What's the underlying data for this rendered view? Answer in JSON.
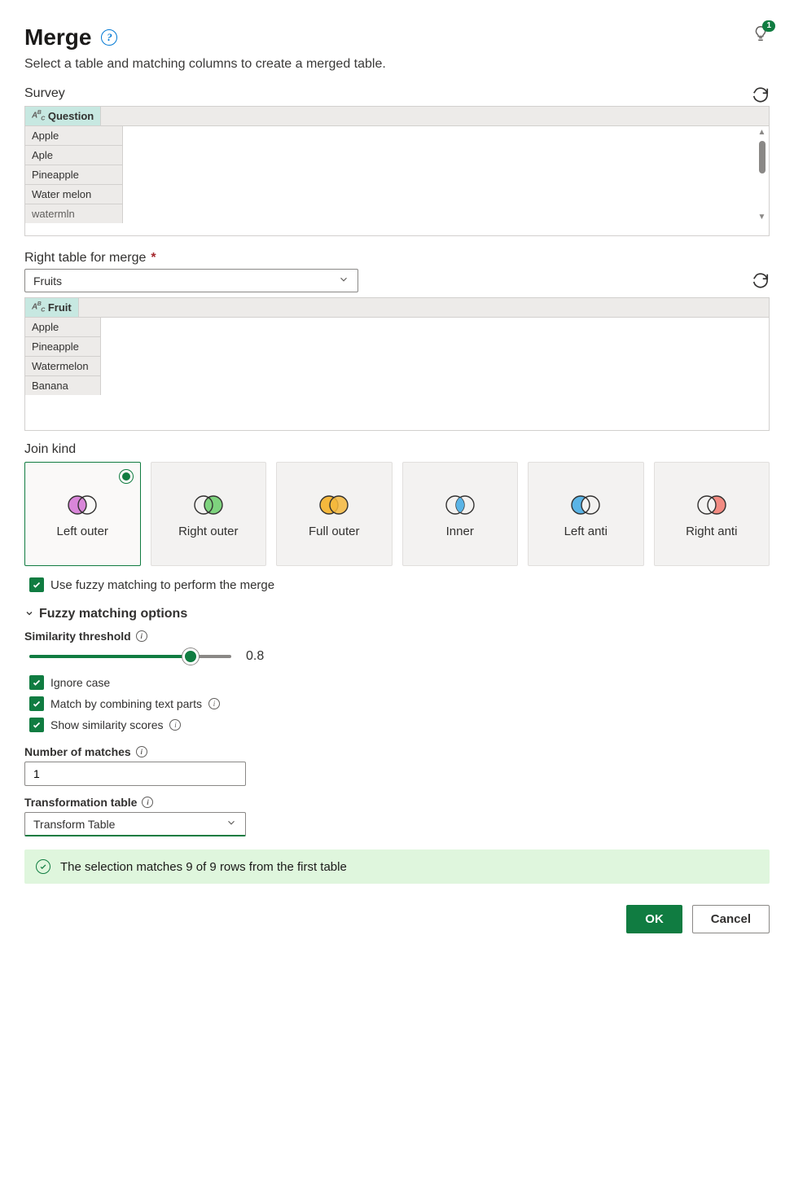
{
  "header": {
    "title": "Merge",
    "subtitle": "Select a table and matching columns to create a merged table.",
    "idea_badge": "1"
  },
  "leftTable": {
    "label": "Survey",
    "column": "Question",
    "rows": [
      "Apple",
      "Aple",
      "Pineapple",
      "Water melon",
      "watermln"
    ]
  },
  "rightTable": {
    "label": "Right table for merge",
    "selected": "Fruits",
    "column": "Fruit",
    "rows": [
      "Apple",
      "Pineapple",
      "Watermelon",
      "Banana"
    ]
  },
  "joinKind": {
    "label": "Join kind",
    "options": [
      {
        "label": "Left outer",
        "selected": true
      },
      {
        "label": "Right outer",
        "selected": false
      },
      {
        "label": "Full outer",
        "selected": false
      },
      {
        "label": "Inner",
        "selected": false
      },
      {
        "label": "Left anti",
        "selected": false
      },
      {
        "label": "Right anti",
        "selected": false
      }
    ]
  },
  "fuzzy": {
    "useFuzzyLabel": "Use fuzzy matching to perform the merge",
    "sectionLabel": "Fuzzy matching options",
    "similarity": {
      "label": "Similarity threshold",
      "value": "0.8",
      "pct": 80
    },
    "ignoreCase": "Ignore case",
    "combineParts": "Match by combining text parts",
    "showScores": "Show similarity scores",
    "numMatches": {
      "label": "Number of matches",
      "value": "1"
    },
    "transformTable": {
      "label": "Transformation table",
      "selected": "Transform Table"
    }
  },
  "status": "The selection matches 9 of 9 rows from the first table",
  "actions": {
    "ok": "OK",
    "cancel": "Cancel"
  }
}
